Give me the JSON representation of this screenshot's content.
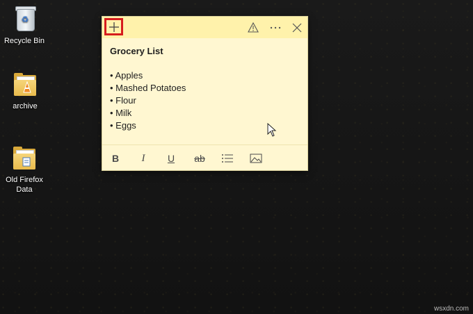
{
  "desktop": {
    "icons": [
      {
        "label": "Recycle Bin"
      },
      {
        "label": "archive"
      },
      {
        "label": "Old Firefox Data"
      }
    ]
  },
  "note": {
    "title": "Grocery List",
    "items": [
      "Apples",
      "Mashed Potatoes",
      "Flour",
      "Milk",
      "Eggs"
    ],
    "titlebar_icons": [
      "plus-icon",
      "warning-icon",
      "more-icon",
      "close-icon"
    ],
    "toolbar": {
      "bold": "B",
      "italic": "I",
      "underline": "U",
      "strike": "ab"
    },
    "colors": {
      "background": "#fff7d1",
      "titlebar": "#fff2ab",
      "highlight": "#d61d1d"
    }
  },
  "watermark": "wsxdn.com"
}
